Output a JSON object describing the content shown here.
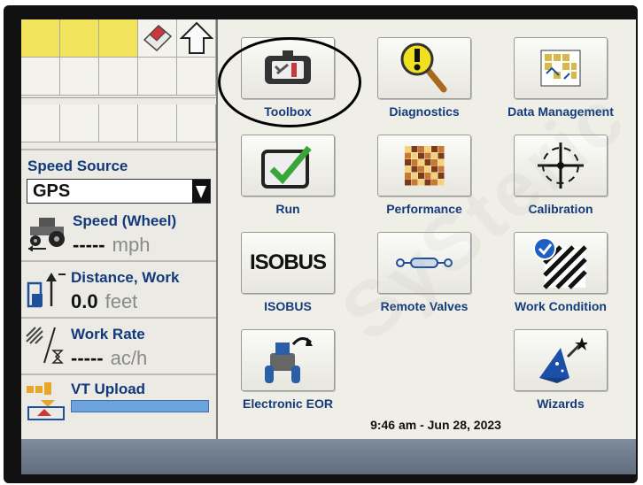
{
  "left_panel": {
    "speed_source_title": "Speed Source",
    "speed_source_value": "GPS",
    "speed": {
      "label": "Speed (Wheel)",
      "value": "-----",
      "unit": "mph"
    },
    "distance": {
      "label": "Distance, Work",
      "value": "0.0",
      "unit": "feet"
    },
    "work_rate": {
      "label": "Work Rate",
      "value": "-----",
      "unit": "ac/h"
    },
    "vt_upload": {
      "label": "VT Upload"
    }
  },
  "apps": [
    {
      "label": "Toolbox",
      "icon": "toolbox-icon"
    },
    {
      "label": "Diagnostics",
      "icon": "diagnostics-icon"
    },
    {
      "label": "Data Management",
      "icon": "data-management-icon"
    },
    {
      "label": "Run",
      "icon": "run-icon"
    },
    {
      "label": "Performance",
      "icon": "performance-icon"
    },
    {
      "label": "Calibration",
      "icon": "calibration-icon"
    },
    {
      "label": "ISOBUS",
      "icon": "isobus-icon",
      "tile_text": "ISOBUS"
    },
    {
      "label": "Remote Valves",
      "icon": "remote-valves-icon"
    },
    {
      "label": "Work Condition",
      "icon": "work-condition-icon"
    },
    {
      "label": "Electronic EOR",
      "icon": "electronic-eor-icon"
    },
    {
      "label": "Wizards",
      "icon": "wizards-icon"
    }
  ],
  "clock": "9:46 am - Jun 28, 2023",
  "colors": {
    "label_blue": "#143c7c",
    "grid_yellow": "#f2e35c",
    "screen_bg": "#efeee7",
    "status_bar": "#6f7d8e",
    "check_green": "#3aa63a"
  }
}
